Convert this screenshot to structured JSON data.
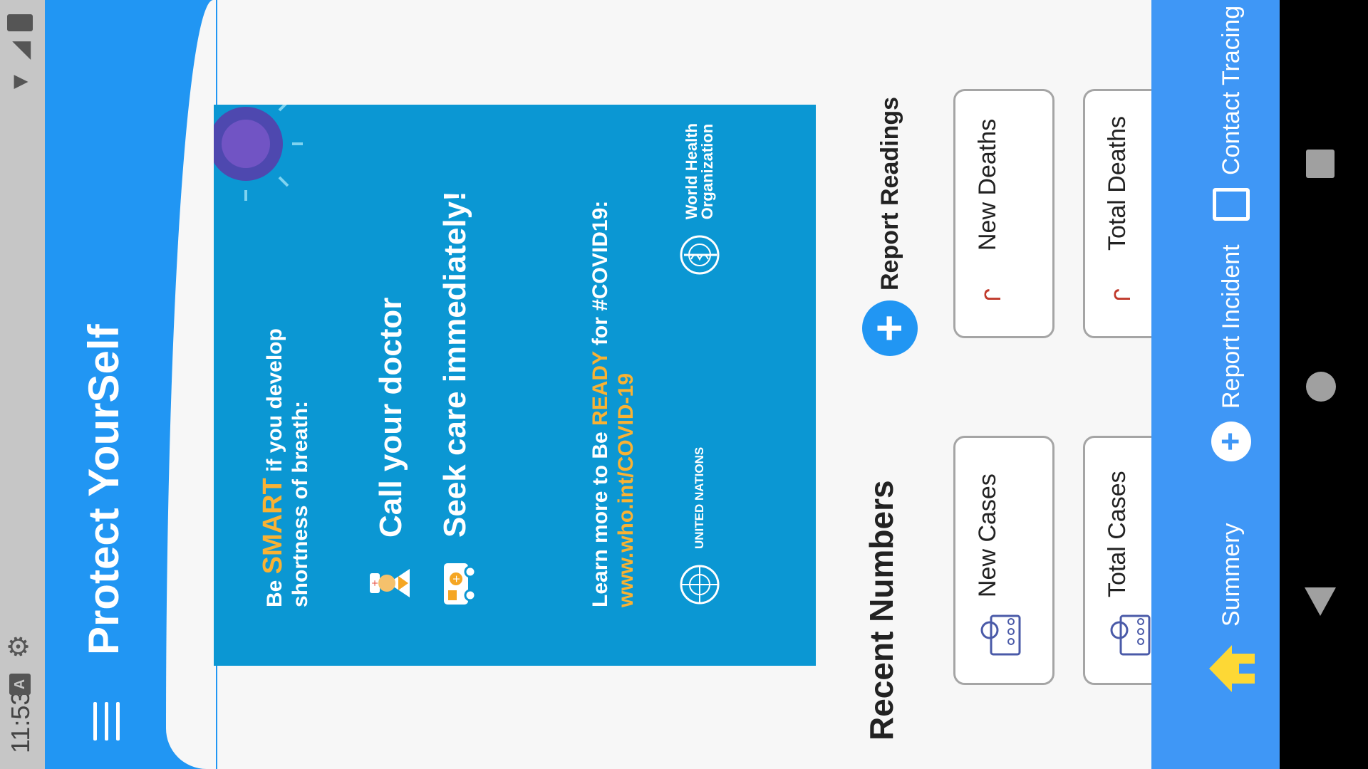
{
  "status_bar": {
    "time": "11:53",
    "a_label": "A"
  },
  "header": {
    "title": "Protect YourSelf"
  },
  "poster": {
    "line1_pre": "Be ",
    "line1_hl": "SMART",
    "line1_post": " if you develop shortness of breath:",
    "item1": "Call your doctor",
    "item2": "Seek care immediately!",
    "learn_pre": "Learn more to Be ",
    "learn_hl": "READY",
    "learn_post": " for #COVID19:",
    "url": "www.who.int/COVID-19",
    "un_label": "UNITED NATIONS",
    "who_label_1": "World Health",
    "who_label_2": "Organization",
    "colors": {
      "background": "#0b97d3",
      "highlight": "#f9b233"
    }
  },
  "recent": {
    "title": "Recent Numbers",
    "report_plus": "+",
    "report_label": "Report Readings"
  },
  "cards": {
    "new_cases": "New Cases",
    "new_deaths": "New Deaths",
    "total_cases": "Total Cases",
    "total_deaths": "Total Deaths",
    "death_symbol": "ᒋ"
  },
  "bottom_nav": {
    "summery": "Summery",
    "incident_plus": "+",
    "incident": "Report Incident",
    "contact": "Contact Tracing"
  },
  "colors": {
    "primary": "#2196f3",
    "nav": "#3f97f6",
    "home_icon": "#fdd835"
  }
}
